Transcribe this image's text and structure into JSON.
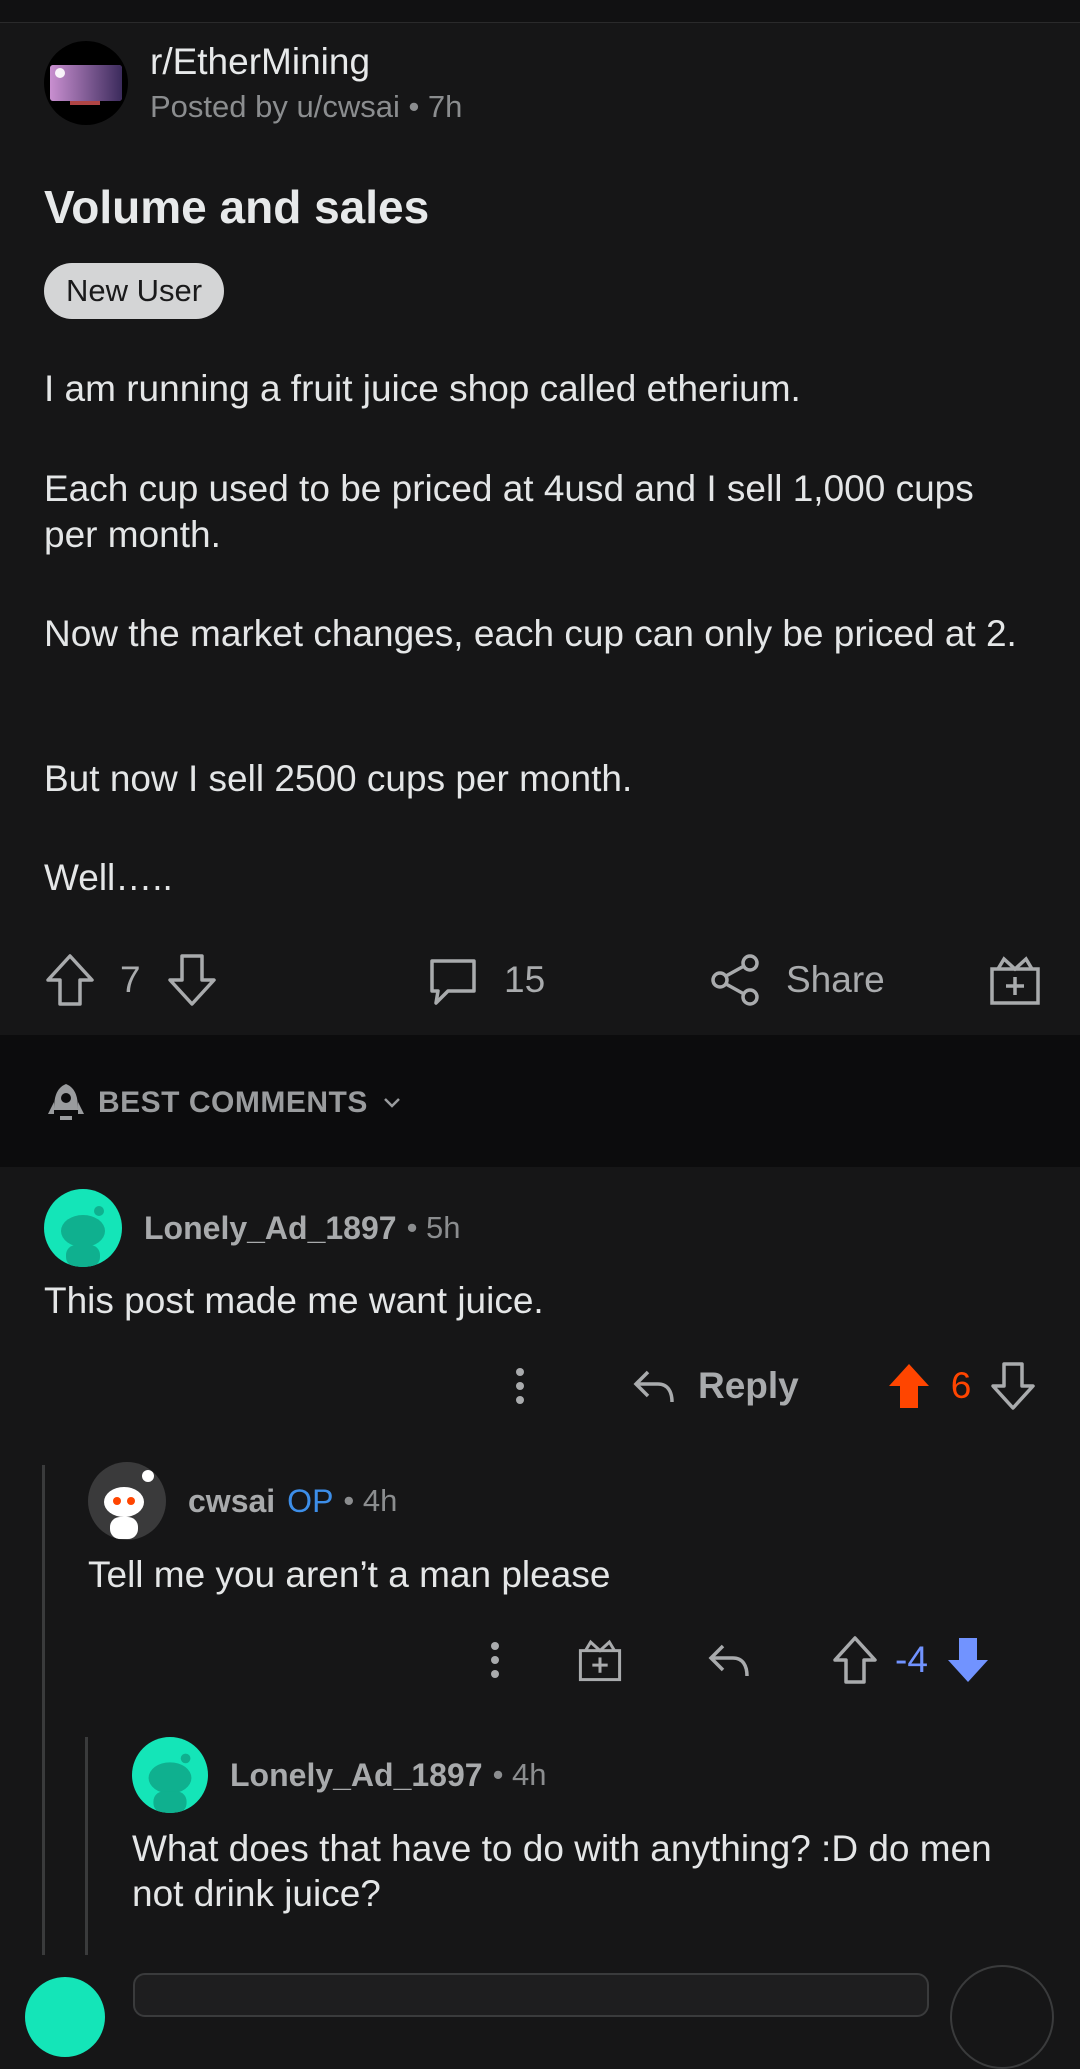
{
  "post": {
    "subreddit": "r/EtherMining",
    "meta": "Posted by u/cwsai • 7h",
    "title": "Volume and sales",
    "flair": "New User",
    "paragraphs": [
      "I am running a fruit juice shop called etherium.",
      "Each cup used to be priced at 4usd and I sell 1,000 cups per month.",
      "Now the market changes, each cup can only be priced at 2.",
      "But now I sell 2500 cups per month.",
      "Well….."
    ],
    "votes": "7",
    "comments": "15",
    "share_label": "Share"
  },
  "sort_label": "BEST COMMENTS",
  "comments": [
    {
      "user": "Lonely_Ad_1897",
      "time": "• 5h",
      "text": "This post made me want juice.",
      "reply_label": "Reply",
      "votes": "6",
      "vote_color": "#ff4500"
    },
    {
      "user": "cwsai",
      "op_badge": "OP",
      "time": "• 4h",
      "text": "Tell me you aren’t a man please",
      "votes": "-4",
      "vote_color": "#7193ff"
    },
    {
      "user": "Lonely_Ad_1897",
      "time": "• 4h",
      "text": "What does that have to do with anything? :D do men not drink juice?"
    }
  ],
  "colors": {
    "background": "#161617",
    "upvote": "#ff4500",
    "downvote": "#7193ff",
    "op": "#3d8ee8",
    "avatar_green": "#14e5b8"
  }
}
